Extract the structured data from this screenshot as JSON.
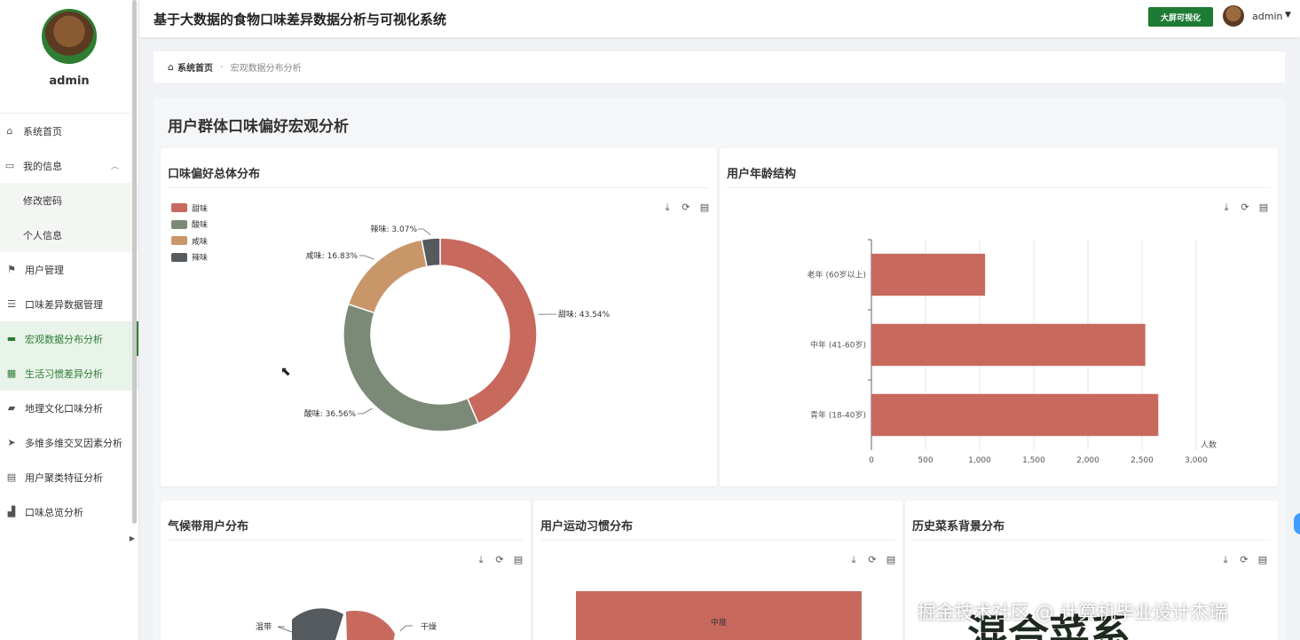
{
  "app": {
    "title": "基于大数据的食物口味差异数据分析与可视化系统"
  },
  "header": {
    "big_screen_label": "大屏可视化",
    "user_name": "admin"
  },
  "sidebar": {
    "profile_name": "admin",
    "items": [
      {
        "label": "系统首页",
        "icon": "home-icon"
      },
      {
        "label": "我的信息",
        "icon": "id-card-icon"
      },
      {
        "label": "修改密码"
      },
      {
        "label": "个人信息"
      },
      {
        "label": "用户管理",
        "icon": "flag-icon"
      },
      {
        "label": "口味差异数据管理",
        "icon": "list-icon"
      },
      {
        "label": "宏观数据分布分析",
        "icon": "briefcase-icon"
      },
      {
        "label": "生活习惯差异分析",
        "icon": "grid-icon"
      },
      {
        "label": "地理文化口味分析",
        "icon": "book-icon"
      },
      {
        "label": "多维多维交叉因素分析",
        "icon": "paper-plane-icon"
      },
      {
        "label": "用户聚类特征分析",
        "icon": "clipboard-icon"
      },
      {
        "label": "口味总览分析",
        "icon": "chart-icon"
      }
    ]
  },
  "breadcrumb": {
    "home": "系统首页",
    "separator": "-",
    "current": "宏观数据分布分析"
  },
  "main": {
    "title": "用户群体口味偏好宏观分析"
  },
  "cards": {
    "taste": {
      "title": "口味偏好总体分布"
    },
    "age": {
      "title": "用户年龄结构"
    },
    "climate": {
      "title": "气候带用户分布"
    },
    "exercise": {
      "title": "用户运动习惯分布"
    },
    "cuisine": {
      "title": "历史菜系背景分布"
    }
  },
  "watermark": "掘金技术社区 @ 计算机毕业设计杰瑞",
  "chart_data": [
    {
      "type": "pie",
      "title": "口味偏好总体分布",
      "categories": [
        "甜味",
        "酸味",
        "咸味",
        "辣味"
      ],
      "values": [
        43.54,
        36.56,
        16.83,
        3.07
      ],
      "labels": [
        "甜味: 43.54%",
        "酸味: 36.56%",
        "咸味: 16.83%",
        "辣味: 3.07%"
      ],
      "colors": [
        "#c8695e",
        "#7a8a77",
        "#c9966a",
        "#555a5e"
      ],
      "legend": "top-left"
    },
    {
      "type": "bar",
      "title": "用户年龄结构",
      "orientation": "horizontal",
      "categories": [
        "老年 (60岁以上)",
        "中年 (41-60岁)",
        "青年 (18-40岁)"
      ],
      "values": [
        1050,
        2530,
        2650
      ],
      "xlim": [
        0,
        3000
      ],
      "xticks": [
        "0",
        "500",
        "1,000",
        "1,500",
        "2,000",
        "2,500",
        "3,000"
      ],
      "xlabel": "人数",
      "color": "#c8695e",
      "grid": true
    },
    {
      "type": "pie",
      "title": "气候带用户分布",
      "visible_labels": [
        "温带",
        "干燥"
      ],
      "colors": [
        "#555a5e",
        "#c8695e"
      ]
    },
    {
      "type": "bar",
      "title": "用户运动习惯分布",
      "visible_labels": [
        "中度"
      ],
      "color": "#c8695e"
    },
    {
      "type": "other",
      "title": "历史菜系背景分布",
      "visible_text": "混合菜系"
    }
  ]
}
